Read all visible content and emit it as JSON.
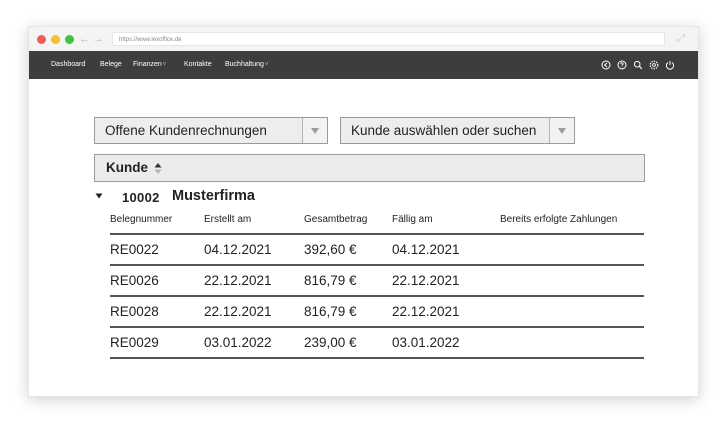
{
  "browser": {
    "url": "https://www.lexoffice.de"
  },
  "nav": {
    "items": [
      {
        "label": "Dashboard"
      },
      {
        "label": "Belege"
      },
      {
        "label": "Finanzen"
      },
      {
        "label": "Kontakte"
      },
      {
        "label": "Buchhaltung"
      }
    ],
    "right_icons": [
      "back-circle-icon",
      "help-icon",
      "search-icon",
      "settings-icon",
      "power-icon"
    ]
  },
  "filters": {
    "invoice_filter": "Offene Kundenrechnungen",
    "customer_search": "Kunde auswählen oder suchen"
  },
  "sort": {
    "label": "Kunde"
  },
  "group": {
    "customer_number": "10002",
    "customer_name": "Musterfirma"
  },
  "table": {
    "columns": [
      "Belegnummer",
      "Erstellt am",
      "Gesamtbetrag",
      "Fällig am",
      "Bereits erfolgte Zahlungen"
    ],
    "rows": [
      {
        "number": "RE0022",
        "created": "04.12.2021",
        "total": "392,60 €",
        "due": "04.12.2021",
        "paid": ""
      },
      {
        "number": "RE0026",
        "created": "22.12.2021",
        "total": "816,79 €",
        "due": "22.12.2021",
        "paid": ""
      },
      {
        "number": "RE0028",
        "created": "22.12.2021",
        "total": "816,79 €",
        "due": "22.12.2021",
        "paid": ""
      },
      {
        "number": "RE0029",
        "created": "03.01.2022",
        "total": "239,00 €",
        "due": "03.01.2022",
        "paid": ""
      }
    ]
  },
  "colors": {
    "nav_bg": "#3d3d3d",
    "control_bg": "#ededed",
    "rule": "#555555"
  }
}
